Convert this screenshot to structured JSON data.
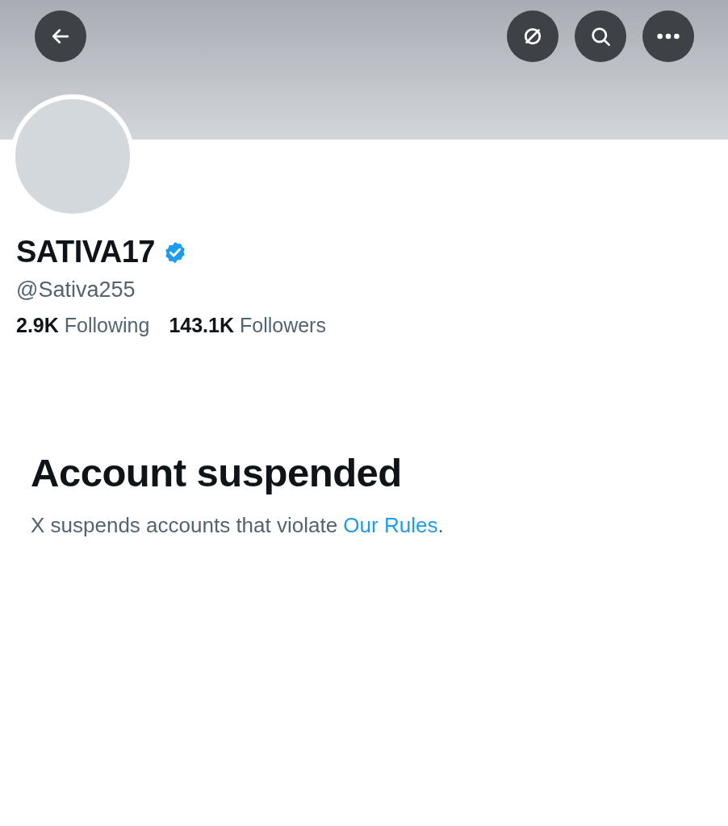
{
  "header_buttons": [
    {
      "kind": "back"
    },
    {
      "kind": "slashed-circle"
    },
    {
      "kind": "search"
    },
    {
      "kind": "more"
    }
  ],
  "profile": {
    "name": "SATIVA17",
    "verified": true,
    "handle": "@Sativa255",
    "stats": [
      {
        "count": "2.9K",
        "unit": "Following"
      },
      {
        "count": "143.1K",
        "unit": "Followers"
      }
    ]
  },
  "notice": {
    "title": "Account suspended",
    "text": "X suspends accounts that violate ",
    "link": "Our Rules",
    "after": "."
  }
}
